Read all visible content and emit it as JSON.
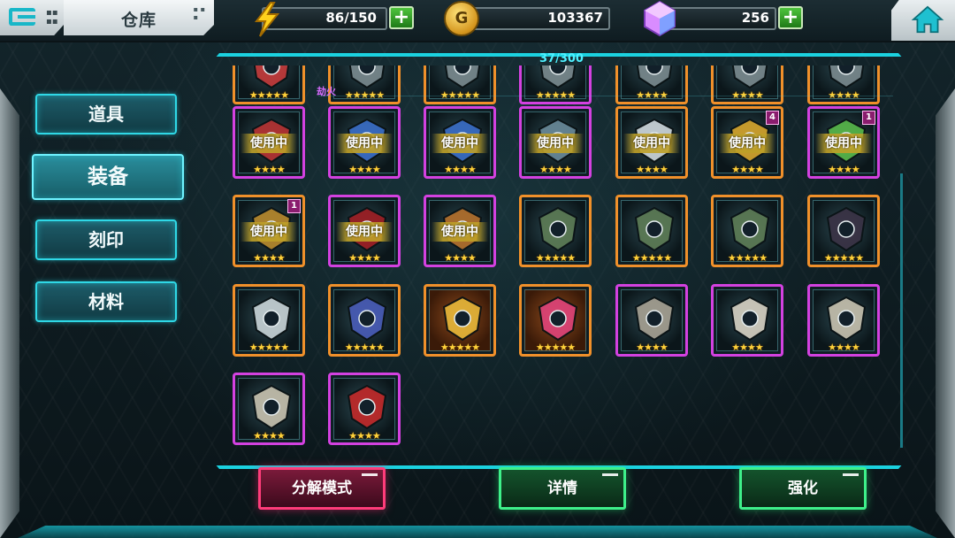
{
  "header": {
    "title": "仓库",
    "energy": "86/150",
    "gold": "103367",
    "gems": "256"
  },
  "tabs": [
    {
      "label": "道具",
      "active": false
    },
    {
      "label": "装备",
      "active": true
    },
    {
      "label": "刻印",
      "active": false
    },
    {
      "label": "材料",
      "active": false
    }
  ],
  "inventory": {
    "capacity": "37/300",
    "floating_label": "劫火",
    "in_use_label": "使用中",
    "stars": {
      "four": "★★★★",
      "five": "★★★★★",
      "three": "★★★"
    },
    "rows": [
      [
        {
          "border": "orange",
          "stars": "five",
          "icon": "red-armor-icon"
        },
        {
          "border": "orange",
          "stars": "five",
          "icon": "gear-icon"
        },
        {
          "border": "orange",
          "stars": "five",
          "icon": "gear-icon"
        },
        {
          "border": "purple",
          "stars": "five",
          "icon": "gear-icon"
        },
        {
          "border": "orange",
          "stars": "four",
          "icon": "gear-icon"
        },
        {
          "border": "orange",
          "stars": "four",
          "icon": "gear-icon"
        },
        {
          "border": "orange",
          "stars": "four",
          "icon": "gear-icon"
        }
      ],
      [
        {
          "border": "purple",
          "stars": "four",
          "icon": "red-wing-armor-icon",
          "in_use": true
        },
        {
          "border": "purple",
          "stars": "four",
          "icon": "blue-mech-armor-icon",
          "in_use": true
        },
        {
          "border": "purple",
          "stars": "four",
          "icon": "blue-mech-armor-icon",
          "in_use": true
        },
        {
          "border": "purple",
          "stars": "four",
          "icon": "shoulder-armor-icon",
          "in_use": true
        },
        {
          "border": "orange",
          "stars": "four",
          "icon": "white-gauntlet-icon",
          "in_use": true
        },
        {
          "border": "orange",
          "stars": "four",
          "icon": "gold-shield-icon",
          "in_use": true,
          "badge": "4"
        },
        {
          "border": "purple",
          "stars": "four",
          "icon": "green-orb-armor-icon",
          "in_use": true,
          "badge": "1"
        }
      ],
      [
        {
          "border": "orange",
          "stars": "four",
          "icon": "crossed-blades-icon",
          "in_use": true,
          "badge": "1"
        },
        {
          "border": "purple",
          "stars": "four",
          "icon": "red-cloak-icon",
          "in_use": true
        },
        {
          "border": "purple",
          "stars": "four",
          "icon": "bronze-orb-icon",
          "in_use": true
        },
        {
          "border": "orange",
          "stars": "five",
          "icon": "tusk-shield-icon"
        },
        {
          "border": "orange",
          "stars": "five",
          "icon": "tusk-shield-icon"
        },
        {
          "border": "orange",
          "stars": "five",
          "icon": "tusk-shield-icon"
        },
        {
          "border": "orange",
          "stars": "five",
          "icon": "dark-bead-armor-icon"
        }
      ],
      [
        {
          "border": "orange",
          "stars": "five",
          "icon": "silver-crown-icon"
        },
        {
          "border": "orange",
          "stars": "five",
          "icon": "star-crossed-swords-icon"
        },
        {
          "border": "orange",
          "stars": "five",
          "icon": "golden-feather-icon",
          "bg": "orange"
        },
        {
          "border": "orange",
          "stars": "five",
          "icon": "pink-crystal-spike-icon",
          "bg": "orange"
        },
        {
          "border": "purple",
          "stars": "four",
          "icon": "skull-emblem-icon"
        },
        {
          "border": "purple",
          "stars": "four",
          "icon": "bone-armor-icon"
        },
        {
          "border": "purple",
          "stars": "four",
          "icon": "tooth-necklace-icon"
        }
      ],
      [
        {
          "border": "purple",
          "stars": "four",
          "icon": "tooth-necklace-icon"
        },
        {
          "border": "purple",
          "stars": "four",
          "icon": "red-eye-shield-icon"
        }
      ]
    ]
  },
  "actions": {
    "decompose": "分解模式",
    "details": "详情",
    "enhance": "强化"
  },
  "colors": {
    "accent": "#1bd2e0",
    "orange_frame": "#f0902a",
    "purple_frame": "#d341e0",
    "decompose": "#ff3c7a",
    "confirm": "#3ef08a",
    "star": "#ffd23a"
  }
}
